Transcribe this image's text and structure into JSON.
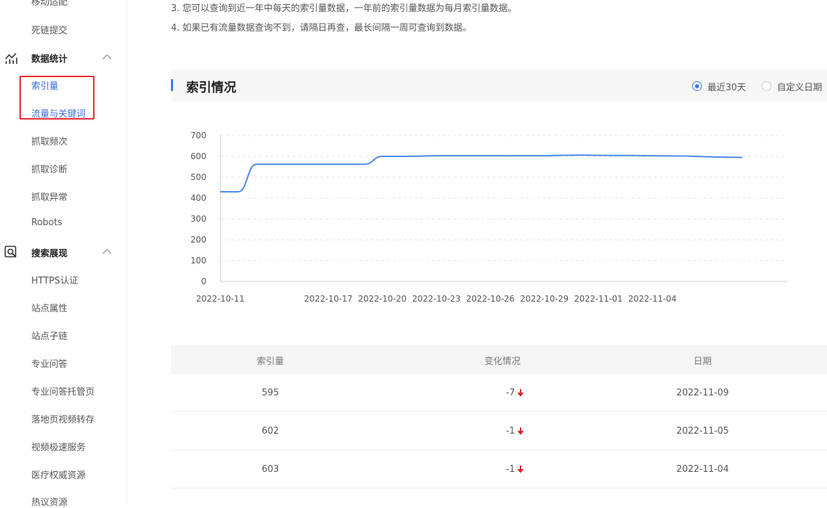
{
  "sidebar": {
    "items_top": [
      {
        "label": "移动适配"
      },
      {
        "label": "死链提交"
      }
    ],
    "group_stats": {
      "label": "数据统计",
      "icon": "chart-icon"
    },
    "stats_items": [
      {
        "label": "索引量",
        "active": true
      },
      {
        "label": "流量与关键词",
        "active": true
      },
      {
        "label": "抓取频次"
      },
      {
        "label": "抓取诊断"
      },
      {
        "label": "抓取异常"
      },
      {
        "label": "Robots"
      }
    ],
    "group_search": {
      "label": "搜索展现",
      "icon": "search-icon"
    },
    "search_items": [
      {
        "label": "HTTPS认证"
      },
      {
        "label": "站点属性"
      },
      {
        "label": "站点子链"
      },
      {
        "label": "专业问答"
      },
      {
        "label": "专业问答托管页"
      },
      {
        "label": "落地页视频转存"
      },
      {
        "label": "视频极速服务"
      },
      {
        "label": "医疗权威资源"
      },
      {
        "label": "热议资源"
      }
    ]
  },
  "notices": [
    "3. 您可以查询到近一年中每天的索引量数据，一年前的索引量数据为每月索引量数据。",
    "4. 如果已有流量数据查询不到，请隔日再查，最长间隔一周可查询到数据。"
  ],
  "section": {
    "title": "索引情况",
    "radio_30days": "最近30天",
    "radio_custom": "自定义日期"
  },
  "chart_data": {
    "type": "line",
    "x": [
      "2022-10-11",
      "2022-10-12",
      "2022-10-13",
      "2022-10-14",
      "2022-10-15",
      "2022-10-16",
      "2022-10-17",
      "2022-10-18",
      "2022-10-19",
      "2022-10-20",
      "2022-10-21",
      "2022-10-22",
      "2022-10-23",
      "2022-10-24",
      "2022-10-25",
      "2022-10-26",
      "2022-10-27",
      "2022-10-28",
      "2022-10-29",
      "2022-10-30",
      "2022-10-31",
      "2022-11-01",
      "2022-11-02",
      "2022-11-03",
      "2022-11-04",
      "2022-11-05",
      "2022-11-09"
    ],
    "series": [
      {
        "values": [
          430,
          430,
          562,
          562,
          562,
          562,
          562,
          562,
          562,
          600,
          600,
          601,
          603,
          603,
          603,
          603,
          603,
          603,
          603,
          605,
          606,
          605,
          604,
          604,
          603,
          602,
          595
        ]
      }
    ],
    "xticks": [
      "2022-10-11",
      "2022-10-17",
      "2022-10-20",
      "2022-10-23",
      "2022-10-26",
      "2022-10-29",
      "2022-11-01",
      "2022-11-04"
    ],
    "yticks": [
      0,
      100,
      200,
      300,
      400,
      500,
      600,
      700
    ],
    "ylim": [
      0,
      700
    ],
    "grid": true,
    "color": "#4a86e8"
  },
  "table": {
    "headers": [
      "索引量",
      "变化情况",
      "日期"
    ],
    "rows": [
      {
        "count": "595",
        "change": "-7",
        "date": "2022-11-09"
      },
      {
        "count": "602",
        "change": "-1",
        "date": "2022-11-05"
      },
      {
        "count": "603",
        "change": "-1",
        "date": "2022-11-04"
      }
    ]
  },
  "colors": {
    "accent": "#3a7bf0",
    "highlight_box": "#e8262e",
    "down_arrow": "#e02020"
  }
}
